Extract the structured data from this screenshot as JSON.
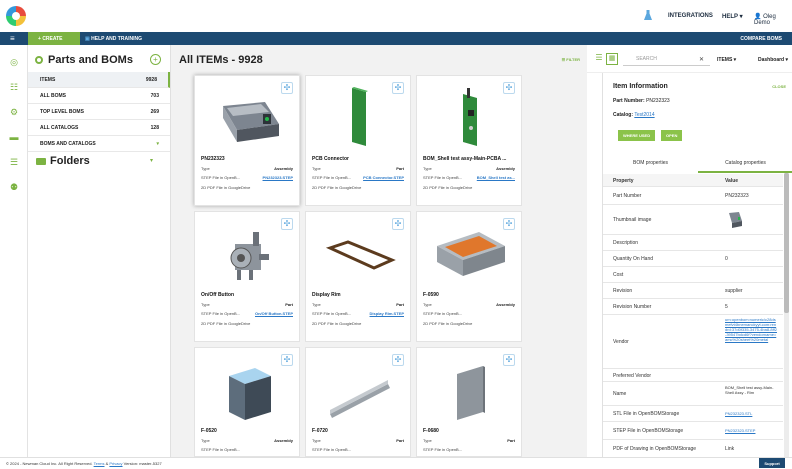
{
  "header": {
    "integrations": "INTEGRATIONS",
    "help": "HELP",
    "user": "Oleg Demo"
  },
  "toolbar": {
    "create": "CREATE",
    "help_training": "HELP AND TRAINING",
    "compare_boms": "COMPARE BOMS"
  },
  "sidebar": {
    "title": "Parts and BOMs",
    "rows": [
      {
        "label": "ITEMS",
        "count": "9928"
      },
      {
        "label": "ALL BOMS",
        "count": "703"
      },
      {
        "label": "TOP LEVEL BOMS",
        "count": "269"
      },
      {
        "label": "ALL CATALOGS",
        "count": "128"
      },
      {
        "label": "BOMS AND CATALOGS",
        "count": ""
      }
    ],
    "folders": "Folders"
  },
  "main": {
    "title": "All ITEMs - 9928",
    "filter": "FILTER",
    "cards": [
      {
        "name": "PN232323",
        "type_label": "Type",
        "type": "Assembly",
        "step_label": "STEP File in OpenB...",
        "step": "PN232323.STEP",
        "pdf": "2D PDF File in GoogleDrive"
      },
      {
        "name": "PCB Connector",
        "type_label": "Type",
        "type": "Part",
        "step_label": "STEP File in OpenB...",
        "step": "PCB Connector.STEP",
        "pdf": "2D PDF File in GoogleDrive"
      },
      {
        "name": "BOM_Shell test assy-Main-PCBA ...",
        "type_label": "Type",
        "type": "Assembly",
        "step_label": "STEP File in OpenB...",
        "step": "BOM_Shell test as...",
        "pdf": "2D PDF File in GoogleDrive"
      },
      {
        "name": "On/Off Button",
        "type_label": "Type",
        "type": "Part",
        "step_label": "STEP File in OpenB...",
        "step": "On/Off Button.STEP",
        "pdf": "2D PDF File in GoogleDrive"
      },
      {
        "name": "Display Rim",
        "type_label": "Type",
        "type": "Part",
        "step_label": "STEP File in OpenB...",
        "step": "Display Rim.STEP",
        "pdf": "2D PDF File in GoogleDrive"
      },
      {
        "name": "F-0590",
        "type_label": "Type",
        "type": "Assembly",
        "step_label": "STEP File in OpenB...",
        "step": "",
        "pdf": "2D PDF File in GoogleDrive"
      },
      {
        "name": "F-0520",
        "type_label": "Type",
        "type": "Assembly",
        "step_label": "STEP File in OpenB...",
        "step": "",
        "pdf": ""
      },
      {
        "name": "F-0720",
        "type_label": "Type",
        "type": "Part",
        "step_label": "STEP File in OpenB...",
        "step": "",
        "pdf": ""
      },
      {
        "name": "F-0680",
        "type_label": "Type",
        "type": "Part",
        "step_label": "STEP File in OpenB...",
        "step": "",
        "pdf": ""
      }
    ]
  },
  "right_toolbar": {
    "search_placeholder": "SEARCH",
    "items": "ITEMS",
    "dashboard": "Dashboard"
  },
  "info": {
    "title": "Item Information",
    "close": "CLOSE",
    "part_number_label": "Part Number:",
    "part_number": "PN232323",
    "catalog_label": "Catalog:",
    "catalog": "Test2014",
    "where_used": "WHERE USED",
    "open": "OPEN",
    "tab_bom": "BOM properties",
    "tab_catalog": "Catalog properties",
    "col_property": "Property",
    "col_value": "Value",
    "props": [
      {
        "k": "Part Number",
        "v": "PN232323"
      },
      {
        "k": "Thumbnail image",
        "v": ""
      },
      {
        "k": "Description",
        "v": ""
      },
      {
        "k": "Quantity On Hand",
        "v": "0"
      },
      {
        "k": "Cost",
        "v": ""
      },
      {
        "k": "Revision",
        "v": "supplier"
      },
      {
        "k": "Revision Number",
        "v": "5"
      },
      {
        "k": "Vendor",
        "v": "urn:openbom:numeric/c28dsmefvt4bnemanckyyt.com:rendrd:37d0f335-3475-4ba8-8ff2-39547bdcd6f?vendorname=amc%20sheet%20metal"
      },
      {
        "k": "Preferred Vendor",
        "v": ""
      },
      {
        "k": "Name",
        "v": "BOM_Shell test assy-Main-Shell Assy - Rim"
      },
      {
        "k": "STL File in OpenBOMStorage",
        "v": "PN232323.STL"
      },
      {
        "k": "STEP File in OpenBOMStorage",
        "v": "PN232323.STEP"
      },
      {
        "k": "PDF of Drawing in OpenBOMStorage",
        "v": "Link"
      }
    ]
  },
  "footer": {
    "copyright": "© 2024 - Newman Cloud Inc. All Right Reserved.",
    "terms": "Terms",
    "amp": "&",
    "privacy": "Privacy",
    "version": "Version: master-5327",
    "support": "Support"
  }
}
